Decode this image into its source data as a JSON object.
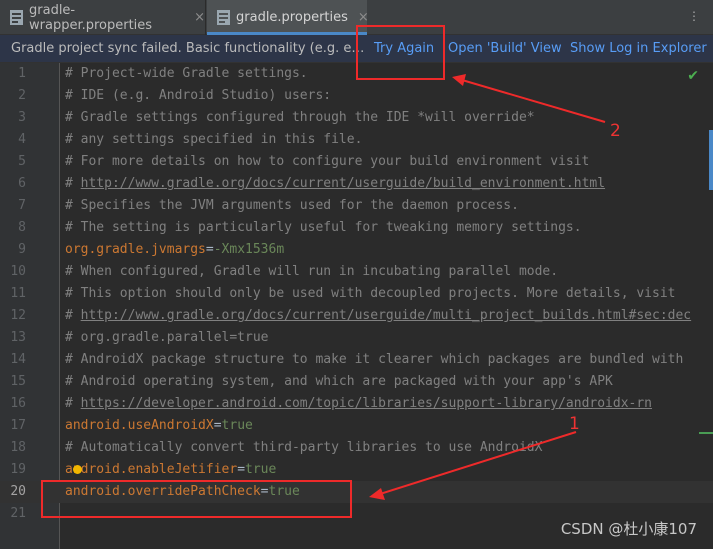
{
  "tabs": [
    {
      "label": "gradle-wrapper.properties",
      "close": "×"
    },
    {
      "label": "gradle.properties",
      "close": "×"
    }
  ],
  "tab_menu": "⋮",
  "notification": {
    "message": "Gradle project sync failed. Basic functionality (e.g. editing, c...",
    "try_again": "Try Again",
    "open_build": "Open 'Build' View",
    "show_log": "Show Log in Explorer"
  },
  "editor": {
    "current_line": 20,
    "status_icon": "checkmark-icon",
    "lines": [
      {
        "n": "1",
        "type": "comment",
        "text": "# Project-wide Gradle settings."
      },
      {
        "n": "2",
        "type": "comment",
        "text": "# IDE (e.g. Android Studio) users:"
      },
      {
        "n": "3",
        "type": "comment",
        "text": "# Gradle settings configured through the IDE *will override*"
      },
      {
        "n": "4",
        "type": "comment",
        "text": "# any settings specified in this file."
      },
      {
        "n": "5",
        "type": "comment",
        "text": "# For more details on how to configure your build environment visit"
      },
      {
        "n": "6",
        "type": "comment-url",
        "prefix": "# ",
        "url": "http://www.gradle.org/docs/current/userguide/build_environment.html"
      },
      {
        "n": "7",
        "type": "comment",
        "text": "# Specifies the JVM arguments used for the daemon process."
      },
      {
        "n": "8",
        "type": "comment",
        "text": "# The setting is particularly useful for tweaking memory settings."
      },
      {
        "n": "9",
        "type": "prop",
        "key": "org.gradle.jvmargs",
        "sep": "=",
        "value": "-Xmx1536m"
      },
      {
        "n": "10",
        "type": "comment",
        "text": "# When configured, Gradle will run in incubating parallel mode."
      },
      {
        "n": "11",
        "type": "comment",
        "text": "# This option should only be used with decoupled projects. More details, visit"
      },
      {
        "n": "12",
        "type": "comment-url",
        "prefix": "# ",
        "url": "http://www.gradle.org/docs/current/userguide/multi_project_builds.html#sec:dec"
      },
      {
        "n": "13",
        "type": "comment",
        "text": "# org.gradle.parallel=true"
      },
      {
        "n": "14",
        "type": "comment",
        "text": "# AndroidX package structure to make it clearer which packages are bundled with"
      },
      {
        "n": "15",
        "type": "comment",
        "text": "# Android operating system, and which are packaged with your app's APK"
      },
      {
        "n": "16",
        "type": "comment-url",
        "prefix": "# ",
        "url": "https://developer.android.com/topic/libraries/support-library/androidx-rn"
      },
      {
        "n": "17",
        "type": "prop",
        "key": "android.useAndroidX",
        "sep": "=",
        "value": "true"
      },
      {
        "n": "18",
        "type": "comment",
        "text": "# Automatically convert third-party libraries to use AndroidX"
      },
      {
        "n": "19",
        "type": "prop",
        "key": "android.enableJetifier",
        "sep": "=",
        "value": "true"
      },
      {
        "n": "20",
        "type": "prop",
        "key": "android.overridePathCheck",
        "sep": "=",
        "value": "true"
      },
      {
        "n": "21",
        "type": "empty"
      }
    ]
  },
  "annotations": {
    "label_1": "1",
    "label_2": "2"
  },
  "watermark": "CSDN @杜小康107",
  "colors": {
    "comment": "#808080",
    "key": "#cc7832",
    "value": "#6a8759",
    "link": "#589df6",
    "annotation": "#ee2a2a"
  }
}
